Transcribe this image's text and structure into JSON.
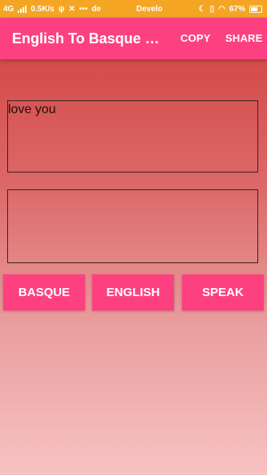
{
  "status_bar": {
    "network": "4G",
    "speed": "0.5K/s",
    "dots": "•••",
    "app_fragment": "de",
    "carrier": "Develo",
    "battery": "67%"
  },
  "app_bar": {
    "title": "English To Basque Co...",
    "copy_label": "COPY",
    "share_label": "SHARE"
  },
  "input": {
    "value": "love you"
  },
  "output": {
    "value": ""
  },
  "buttons": {
    "basque": "BASQUE",
    "english": "ENGLISH",
    "speak": "SPEAK"
  },
  "colors": {
    "status_bar": "#f5a524",
    "primary": "#fd4180",
    "bg_top": "#d23c3c",
    "bg_bottom": "#f7c2c2"
  }
}
